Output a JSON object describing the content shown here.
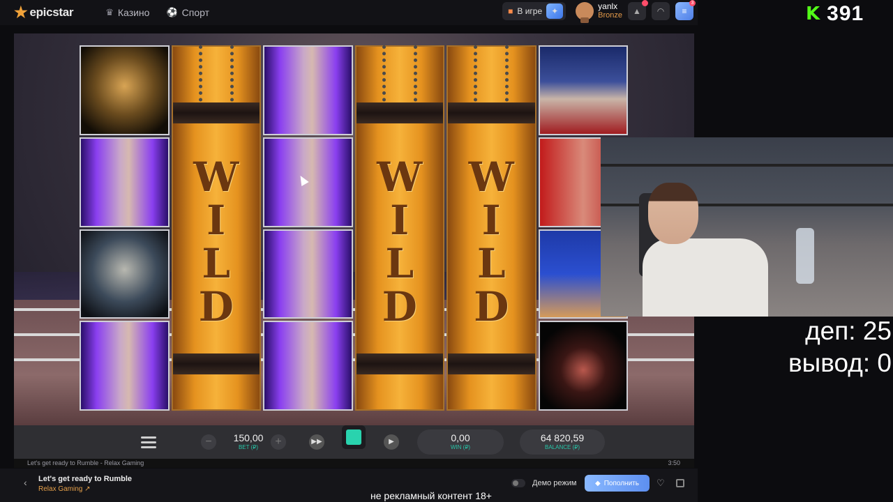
{
  "header": {
    "logo": "epicstar",
    "nav": [
      {
        "label": "Казино",
        "icon": "crown-icon"
      },
      {
        "label": "Спорт",
        "icon": "ball-icon"
      }
    ],
    "in_game_label": "В игре",
    "user": {
      "name": "yanlx",
      "rank": "Bronze"
    },
    "menu_badge": "3"
  },
  "stream": {
    "kick_logo": "K",
    "viewer_count": "391",
    "dep_label": "деп: 25",
    "withdraw_label": "вывод: 0"
  },
  "slot": {
    "wild_text": [
      "W",
      "I",
      "L",
      "D"
    ],
    "reels": [
      {
        "type": "symbols",
        "cells": [
          "gold",
          "purple",
          "mixed",
          "purple"
        ]
      },
      {
        "type": "wild"
      },
      {
        "type": "symbols",
        "cells": [
          "purple",
          "purple",
          "purple",
          "purple"
        ]
      },
      {
        "type": "wild"
      },
      {
        "type": "wild"
      },
      {
        "type": "symbols",
        "cells": [
          "bluered",
          "red",
          "blue",
          "dark"
        ]
      }
    ]
  },
  "controls": {
    "bet_value": "150,00",
    "bet_label": "BET (₽)",
    "win_value": "0,00",
    "win_label": "WIN (₽)",
    "balance_value": "64 820,59",
    "balance_label": "BALANCE (₽)",
    "minus": "−",
    "plus": "+"
  },
  "game_bar": {
    "caption": "Let's get ready to Rumble - Relax Gaming",
    "time": "3:50"
  },
  "footer": {
    "game_title": "Let's get ready to Rumble",
    "provider": "Relax Gaming",
    "demo_label": "Демо режим",
    "topup_label": "Пополнить",
    "disclaimer": "не рекламный контент 18+"
  },
  "colors": {
    "accent": "#29d3ae",
    "kick_green": "#53fc18",
    "provider_orange": "#e5a04a"
  }
}
